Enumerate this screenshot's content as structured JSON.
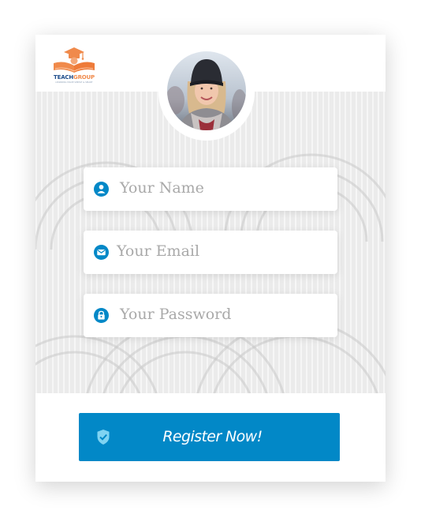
{
  "logo": {
    "name_part1": "TEACH",
    "name_part2": "GROUP",
    "tagline": "LEARNING MADE SIMPLE & SMART"
  },
  "form": {
    "name_placeholder": "Your Name",
    "email_placeholder": "Your Email",
    "password_placeholder": "Your Password",
    "submit_label": "Register Now!"
  },
  "colors": {
    "accent": "#0288c7",
    "logo_orange": "#f08a4b",
    "logo_navy": "#1f4e8c",
    "background": "#ebebeb"
  },
  "icons": [
    "user-icon",
    "envelope-icon",
    "lock-icon",
    "shield-check-icon"
  ]
}
